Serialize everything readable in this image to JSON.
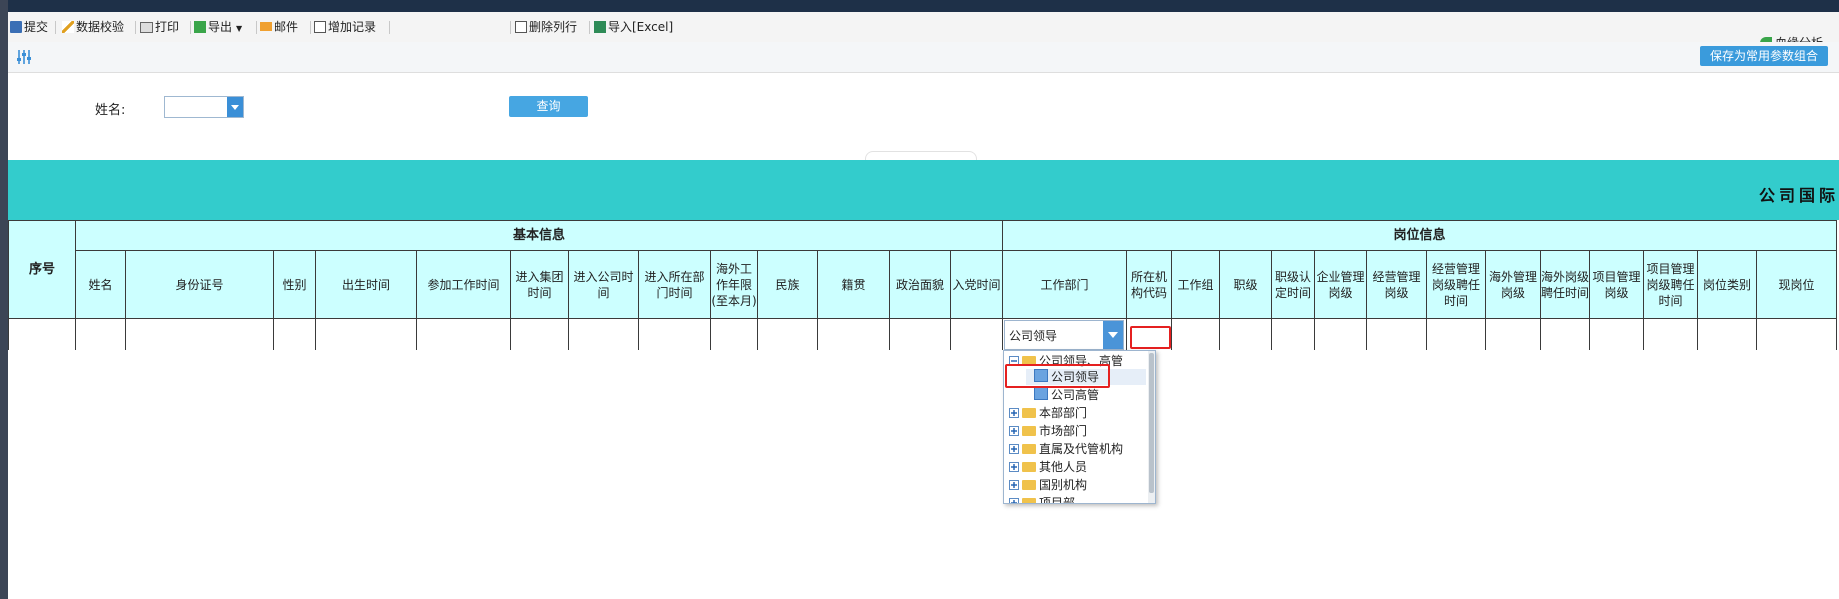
{
  "toolbar": {
    "submit": "提交",
    "validate": "数据校验",
    "print": "打印",
    "export": "导出",
    "mail": "邮件",
    "add_record": "增加记录",
    "delete_row": "删除列行",
    "import": "导入[Excel]",
    "blood_analysis": "血缘分析"
  },
  "params": {
    "save_label": "保存为常用参数组合",
    "name_label": "姓名:",
    "name_value": "",
    "query_label": "查询"
  },
  "report": {
    "banner_title": "公司国际",
    "seq": "序号",
    "groups": {
      "basic": "基本信息",
      "position": "岗位信息"
    },
    "columns": [
      "姓名",
      "身份证号",
      "性别",
      "出生时间",
      "参加工作时间",
      "进入集团时间",
      "进入公司时间",
      "进入所在部门时间",
      "海外工作年限(至本月)",
      "民族",
      "籍贯",
      "政治面貌",
      "入党时间",
      "工作部门",
      "所在机构代码",
      "工作组",
      "职级",
      "职级认定时间",
      "企业管理岗级",
      "经营管理岗级",
      "经营管理岗级聘任时间",
      "海外管理岗级",
      "海外岗级聘任时间",
      "项目管理岗级",
      "项目管理岗级聘任时间",
      "岗位类别",
      "现岗位"
    ]
  },
  "dropdown": {
    "selected": "公司领导",
    "tree": [
      {
        "label": "公司领导、高管",
        "expanded": true,
        "children": [
          "公司领导",
          "公司高管"
        ]
      },
      {
        "label": "本部部门"
      },
      {
        "label": "市场部门"
      },
      {
        "label": "直属及代管机构"
      },
      {
        "label": "其他人员"
      },
      {
        "label": "国别机构"
      },
      {
        "label": "项目部"
      }
    ]
  },
  "colors": {
    "banner": "#33cccc",
    "header": "#ccffff",
    "highlight": "#e52020",
    "button": "#46a6e2"
  }
}
